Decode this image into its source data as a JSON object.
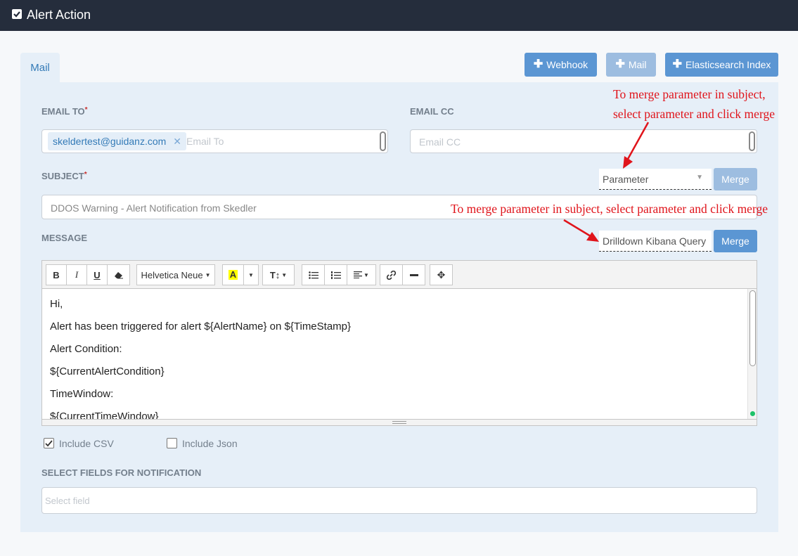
{
  "header": {
    "title": "Alert Action"
  },
  "actions": {
    "webhook": "Webhook",
    "mail": "Mail",
    "elasticsearch": "Elasticsearch Index"
  },
  "tabs": [
    {
      "label": "Mail"
    }
  ],
  "form": {
    "email_to_label": "EMAIL TO",
    "email_to_tag": "skeldertest@guidanz.com",
    "email_to_placeholder": "Email To",
    "email_cc_label": "EMAIL CC",
    "email_cc_placeholder": "Email CC",
    "subject_label": "SUBJECT",
    "subject_value": "DDOS Warning - Alert Notification from Skedler",
    "subject_param": "Parameter",
    "merge": "Merge",
    "message_label": "MESSAGE",
    "message_param": "Drilldown Kibana Query",
    "include_csv": "Include CSV",
    "include_json": "Include Json",
    "fields_label": "SELECT FIELDS FOR NOTIFICATION",
    "fields_placeholder": "Select field"
  },
  "annotations": {
    "subject_line1": "To merge parameter in subject,",
    "subject_line2": "select parameter and click merge",
    "message": "To merge parameter in subject, select parameter and click merge",
    "color": "#e0141b"
  },
  "toolbar": {
    "font": "Helvetica Neue"
  },
  "editor": {
    "lines": [
      "Hi,",
      "Alert has been triggered for alert ${AlertName} on ${TimeStamp}",
      "Alert Condition:",
      "${CurrentAlertCondition}",
      "TimeWindow:",
      "${CurrentTimeWindow}"
    ]
  },
  "colors": {
    "header_bg": "#252d3c",
    "primary": "#5b96d3",
    "panel_bg": "#e6eff8"
  }
}
